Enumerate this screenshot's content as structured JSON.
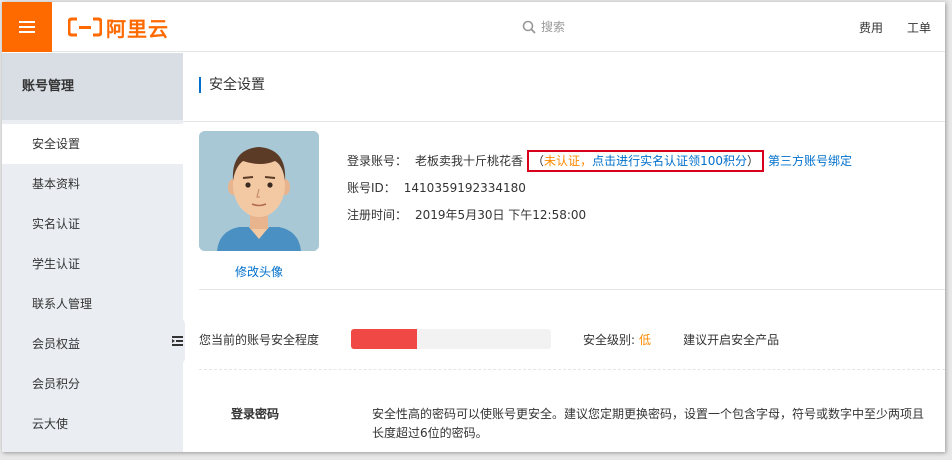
{
  "header": {
    "logo_text": "阿里云",
    "search_placeholder": "搜索",
    "links": [
      "费用",
      "工单"
    ]
  },
  "sidebar": {
    "title": "账号管理",
    "items": [
      {
        "label": "安全设置",
        "active": true
      },
      {
        "label": "基本资料"
      },
      {
        "label": "实名认证"
      },
      {
        "label": "学生认证"
      },
      {
        "label": "联系人管理"
      },
      {
        "label": "会员权益"
      },
      {
        "label": "会员积分"
      },
      {
        "label": "云大使"
      }
    ]
  },
  "main": {
    "page_title": "安全设置",
    "avatar_link": "修改头像",
    "account": {
      "login_label": "登录账号：",
      "login_value": "老板卖我十斤桃花香",
      "notice_open": "（",
      "notice_warn": "未认证",
      "notice_sep": "，",
      "notice_link": "点击进行实名认证领100积分",
      "notice_close": "）",
      "bind_link": "第三方账号绑定",
      "id_label": "账号ID：",
      "id_value": "1410359192334180",
      "reg_label": "注册时间：",
      "reg_value": "2019年5月30日 下午12:58:00"
    },
    "security": {
      "degree_label": "您当前的账号安全程度",
      "level_fraction": 0.33,
      "level_label": "安全级别:",
      "level_value": "低",
      "advice": "建议开启安全产品"
    },
    "password": {
      "title": "登录密码",
      "desc": "安全性高的密码可以使账号更安全。建议您定期更换密码，设置一个包含字母，符号或数字中至少两项且长度超过6位的密码。"
    }
  },
  "colors": {
    "brand": "#ff6a00",
    "link": "#0070cc",
    "warning": "#ff8a00",
    "danger": "#f04844",
    "highlight_box": "#d9001b"
  },
  "icons": [
    "menu-icon",
    "search-icon",
    "collapse-icon"
  ]
}
